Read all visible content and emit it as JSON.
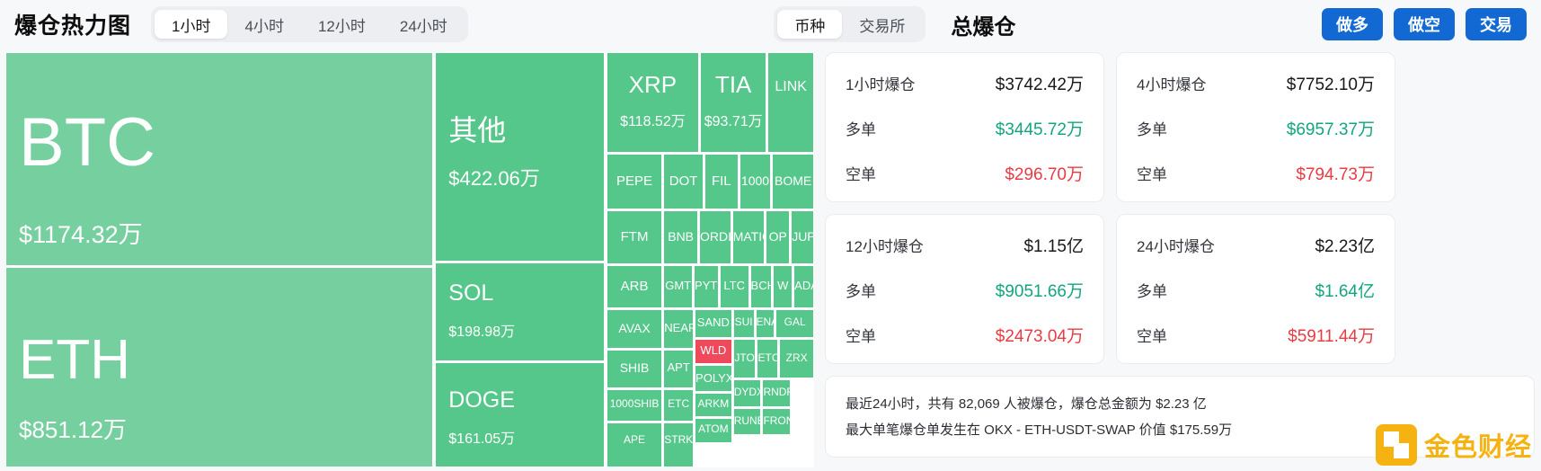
{
  "header": {
    "title": "爆仓热力图",
    "time_tabs": [
      {
        "label": "1小时",
        "active": true
      },
      {
        "label": "4小时",
        "active": false
      },
      {
        "label": "12小时",
        "active": false
      },
      {
        "label": "24小时",
        "active": false
      }
    ],
    "view_tabs": [
      {
        "label": "币种",
        "active": true
      },
      {
        "label": "交易所",
        "active": false
      }
    ],
    "total_label": "总爆仓",
    "buttons": [
      {
        "label": "做多",
        "color": "#1269d3"
      },
      {
        "label": "做空",
        "color": "#1269d3"
      },
      {
        "label": "交易",
        "color": "#1269d3"
      }
    ]
  },
  "chart_data": {
    "type": "treemap",
    "title": "爆仓热力图",
    "unit": "USD",
    "colors": {
      "up": "#5cc98b",
      "up_light": "#76cf9e",
      "down": "#ef4a5c"
    },
    "tiles": [
      {
        "symbol": "BTC",
        "value": "$1174.32万",
        "color": "light"
      },
      {
        "symbol": "ETH",
        "value": "$851.12万",
        "color": "light"
      },
      {
        "symbol": "其他",
        "value": "$422.06万",
        "color": "mid"
      },
      {
        "symbol": "SOL",
        "value": "$198.98万",
        "color": "mid"
      },
      {
        "symbol": "DOGE",
        "value": "$161.05万",
        "color": "mid"
      },
      {
        "symbol": "XRP",
        "value": "$118.52万",
        "color": "mid"
      },
      {
        "symbol": "TIA",
        "value": "$93.71万",
        "color": "mid"
      },
      {
        "symbol": "LINK",
        "value": "",
        "color": "mid"
      },
      {
        "symbol": "PEPE",
        "value": "",
        "color": "mid"
      },
      {
        "symbol": "DOT",
        "value": "",
        "color": "mid"
      },
      {
        "symbol": "FIL",
        "value": "",
        "color": "mid"
      },
      {
        "symbol": "1000",
        "value": "",
        "color": "mid"
      },
      {
        "symbol": "BOME",
        "value": "",
        "color": "mid"
      },
      {
        "symbol": "FTM",
        "value": "",
        "color": "mid"
      },
      {
        "symbol": "BNB",
        "value": "",
        "color": "mid"
      },
      {
        "symbol": "ORDI",
        "value": "",
        "color": "mid"
      },
      {
        "symbol": "MATIC",
        "value": "",
        "color": "mid"
      },
      {
        "symbol": "OP",
        "value": "",
        "color": "mid"
      },
      {
        "symbol": "JUP",
        "value": "",
        "color": "mid"
      },
      {
        "symbol": "ARB",
        "value": "",
        "color": "mid"
      },
      {
        "symbol": "GMT",
        "value": "",
        "color": "mid"
      },
      {
        "symbol": "PYTH",
        "value": "",
        "color": "mid"
      },
      {
        "symbol": "LTC",
        "value": "",
        "color": "mid"
      },
      {
        "symbol": "BCH",
        "value": "",
        "color": "mid"
      },
      {
        "symbol": "W",
        "value": "",
        "color": "mid"
      },
      {
        "symbol": "ADA",
        "value": "",
        "color": "mid"
      },
      {
        "symbol": "AVAX",
        "value": "",
        "color": "mid"
      },
      {
        "symbol": "NEAR",
        "value": "",
        "color": "mid"
      },
      {
        "symbol": "SAND",
        "value": "",
        "color": "mid"
      },
      {
        "symbol": "SUI",
        "value": "",
        "color": "mid"
      },
      {
        "symbol": "ENA",
        "value": "",
        "color": "mid"
      },
      {
        "symbol": "GAL",
        "value": "",
        "color": "mid"
      },
      {
        "symbol": "SHIB",
        "value": "",
        "color": "mid"
      },
      {
        "symbol": "WLD",
        "value": "",
        "color": "red"
      },
      {
        "symbol": "APT",
        "value": "",
        "color": "mid"
      },
      {
        "symbol": "POLYX",
        "value": "",
        "color": "mid"
      },
      {
        "symbol": "JTO",
        "value": "",
        "color": "mid"
      },
      {
        "symbol": "ETC",
        "value": "",
        "color": "mid"
      },
      {
        "symbol": "ZRX",
        "value": "",
        "color": "mid"
      },
      {
        "symbol": "1000SHIB",
        "value": "",
        "color": "mid"
      },
      {
        "symbol": "ETC",
        "value": "",
        "color": "mid"
      },
      {
        "symbol": "ARKM",
        "value": "",
        "color": "mid"
      },
      {
        "symbol": "DYDX",
        "value": "",
        "color": "mid"
      },
      {
        "symbol": "RNDR",
        "value": "",
        "color": "mid"
      },
      {
        "symbol": "APE",
        "value": "",
        "color": "mid"
      },
      {
        "symbol": "STRK",
        "value": "",
        "color": "mid"
      },
      {
        "symbol": "ATOM",
        "value": "",
        "color": "mid"
      },
      {
        "symbol": "RUNE",
        "value": "",
        "color": "mid"
      },
      {
        "symbol": "FRONT",
        "value": "",
        "color": "mid"
      }
    ]
  },
  "stats": {
    "long_label": "多单",
    "short_label": "空单",
    "cards": [
      {
        "title": "1小时爆仓",
        "total": "$3742.42万",
        "long": "$3445.72万",
        "short": "$296.70万"
      },
      {
        "title": "4小时爆仓",
        "total": "$7752.10万",
        "long": "$6957.37万",
        "short": "$794.73万"
      },
      {
        "title": "12小时爆仓",
        "total": "$1.15亿",
        "long": "$9051.66万",
        "short": "$2473.04万"
      },
      {
        "title": "24小时爆仓",
        "total": "$2.23亿",
        "long": "$1.64亿",
        "short": "$5911.44万"
      }
    ]
  },
  "summary": {
    "line1": "最近24小时，共有 82,069 人被爆仓，爆仓总金额为 $2.23 亿",
    "line2": "最大单笔爆仓单发生在 OKX - ETH-USDT-SWAP 价值 $175.59万"
  },
  "watermark": {
    "text": "金色财经",
    "color": "#f5b211"
  }
}
